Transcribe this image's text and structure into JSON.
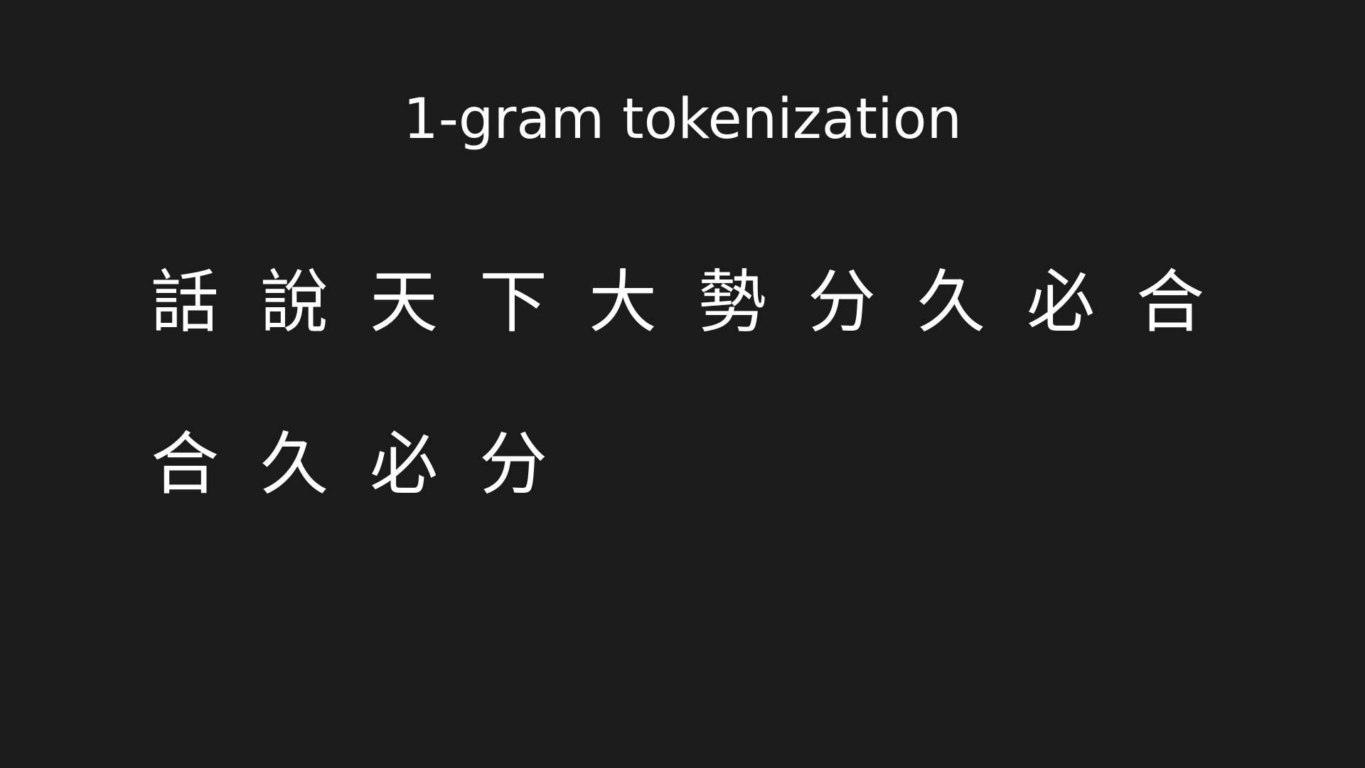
{
  "slide": {
    "title": "1-gram tokenization",
    "rows": [
      [
        "話",
        "說",
        "天",
        "下",
        "大",
        "勢",
        "分",
        "久",
        "必",
        "合"
      ],
      [
        "合",
        "久",
        "必",
        "分"
      ]
    ]
  },
  "colors": {
    "background": "#1b1b1b",
    "text": "#ffffff"
  }
}
